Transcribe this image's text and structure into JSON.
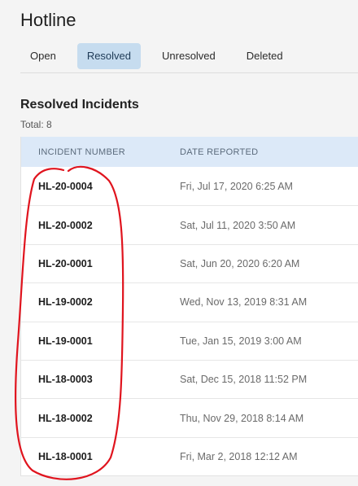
{
  "page": {
    "title": "Hotline"
  },
  "tabs": [
    {
      "label": "Open",
      "active": false
    },
    {
      "label": "Resolved",
      "active": true
    },
    {
      "label": "Unresolved",
      "active": false
    },
    {
      "label": "Deleted",
      "active": false
    }
  ],
  "section": {
    "title": "Resolved Incidents",
    "total": "Total: 8"
  },
  "table": {
    "headers": {
      "incident_number": "INCIDENT NUMBER",
      "date_reported": "DATE REPORTED"
    },
    "rows": [
      {
        "incident_number": "HL-20-0004",
        "date_reported": "Fri, Jul 17, 2020 6:25 AM"
      },
      {
        "incident_number": "HL-20-0002",
        "date_reported": "Sat, Jul 11, 2020 3:50 AM"
      },
      {
        "incident_number": "HL-20-0001",
        "date_reported": "Sat, Jun 20, 2020 6:20 AM"
      },
      {
        "incident_number": "HL-19-0002",
        "date_reported": "Wed, Nov 13, 2019 8:31 AM"
      },
      {
        "incident_number": "HL-19-0001",
        "date_reported": "Tue, Jan 15, 2019 3:00 AM"
      },
      {
        "incident_number": "HL-18-0003",
        "date_reported": "Sat, Dec 15, 2018 11:52 PM"
      },
      {
        "incident_number": "HL-18-0002",
        "date_reported": "Thu, Nov 29, 2018 8:14 AM"
      },
      {
        "incident_number": "HL-18-0001",
        "date_reported": "Fri, Mar 2, 2018 12:12 AM"
      }
    ]
  },
  "colors": {
    "active_tab_bg": "#c6dcef",
    "table_header_bg": "#dce9f8",
    "annotation_stroke": "#e0141e"
  }
}
